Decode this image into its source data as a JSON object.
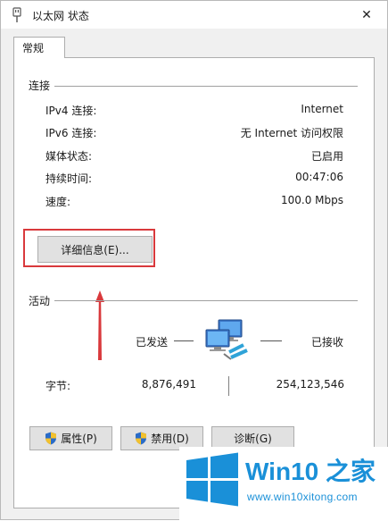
{
  "window": {
    "title": "以太网 状态",
    "close_glyph": "✕"
  },
  "tabs": [
    {
      "label": "常规"
    }
  ],
  "connection": {
    "group_label": "连接",
    "rows": [
      {
        "label": "IPv4 连接:",
        "value": "Internet"
      },
      {
        "label": "IPv6 连接:",
        "value": "无 Internet 访问权限"
      },
      {
        "label": "媒体状态:",
        "value": "已启用"
      },
      {
        "label": "持续时间:",
        "value": "00:47:06"
      },
      {
        "label": "速度:",
        "value": "100.0 Mbps"
      }
    ],
    "details_button": "详细信息(E)..."
  },
  "activity": {
    "group_label": "活动",
    "sent_label": "已发送",
    "received_label": "已接收",
    "bytes_label": "字节:",
    "bytes_sent": "8,876,491",
    "bytes_received": "254,123,546"
  },
  "buttons": {
    "properties": "属性(P)",
    "disable": "禁用(D)",
    "diagnose": "诊断(G)"
  },
  "watermark": {
    "brand": "Win10 之家",
    "url": "www.win10xitong.com"
  },
  "colors": {
    "annotation_red": "#d9393c",
    "logo_blue": "#1a90d8",
    "dialog_bg": "#f0f0f0"
  },
  "icons": {
    "title": "ethernet-plug-icon",
    "close": "close-icon",
    "network": "network-computers-icon",
    "shield": "uac-shield-icon",
    "arrow": "red-arrow-annotation",
    "logo": "windows-logo-icon"
  }
}
